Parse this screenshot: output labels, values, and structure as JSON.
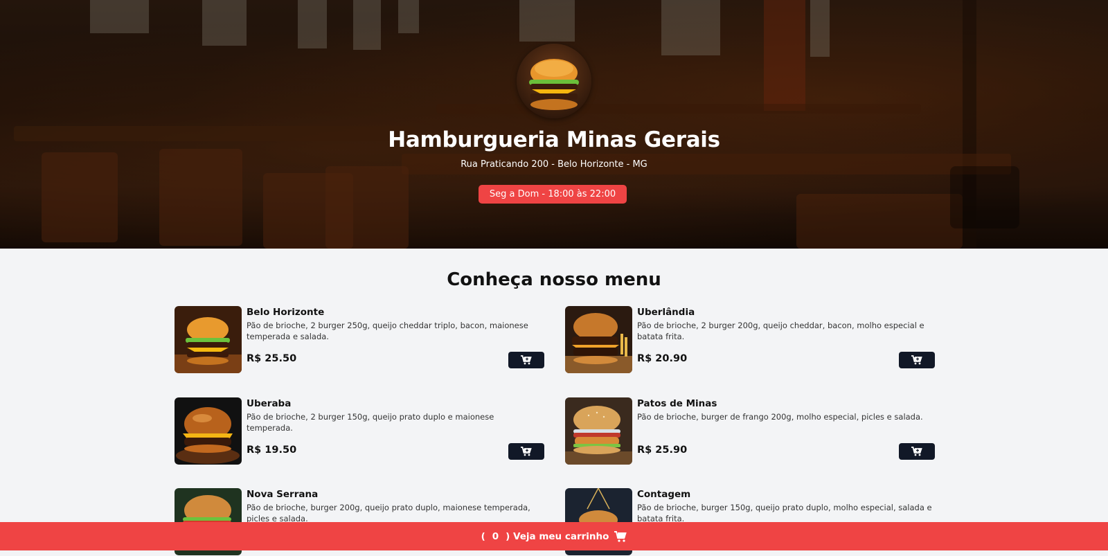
{
  "header": {
    "title": "Hamburgueria Minas Gerais",
    "address": "Rua Praticando 200 - Belo Horizonte - MG",
    "hours": "Seg a Dom - 18:00 às 22:00"
  },
  "menu": {
    "title": "Conheça nosso menu",
    "items": [
      {
        "name": "Belo Horizonte",
        "description": "Pão de brioche, 2 burger 250g, queijo cheddar triplo, bacon, maionese temperada e salada.",
        "price": "R$ 25.50",
        "button_icon": "cart-plus-icon"
      },
      {
        "name": "Uberlândia",
        "description": "Pão de brioche, 2 burger 200g, queijo cheddar, bacon, molho especial e batata frita.",
        "price": "R$ 20.90",
        "button_icon": "cart-plus-icon"
      },
      {
        "name": "Uberaba",
        "description": "Pão de brioche, 2 burger 150g, queijo prato duplo e maionese temperada.",
        "price": "R$ 19.50",
        "button_icon": "cart-plus-icon"
      },
      {
        "name": "Patos de Minas",
        "description": "Pão de brioche, burger de frango 200g, molho especial, picles e salada.",
        "price": "R$ 25.90",
        "button_icon": "cart-plus-icon"
      },
      {
        "name": "Nova Serrana",
        "description": "Pão de brioche, burger 200g, queijo prato duplo, maionese temperada, picles e salada.",
        "price": "",
        "button_icon": "cart-plus-icon"
      },
      {
        "name": "Contagem",
        "description": "Pão de brioche, burger 150g, queijo prato duplo, molho especial, salada e batata frita.",
        "price": "",
        "button_icon": "cart-plus-icon"
      }
    ]
  },
  "footer": {
    "open_paren": "(",
    "cart_count": "0",
    "label": ") Veja meu carrinho",
    "icon": "cart-icon"
  },
  "colors": {
    "accent": "#ef4444",
    "dark_button": "#111827",
    "background": "#f3f4f6"
  }
}
